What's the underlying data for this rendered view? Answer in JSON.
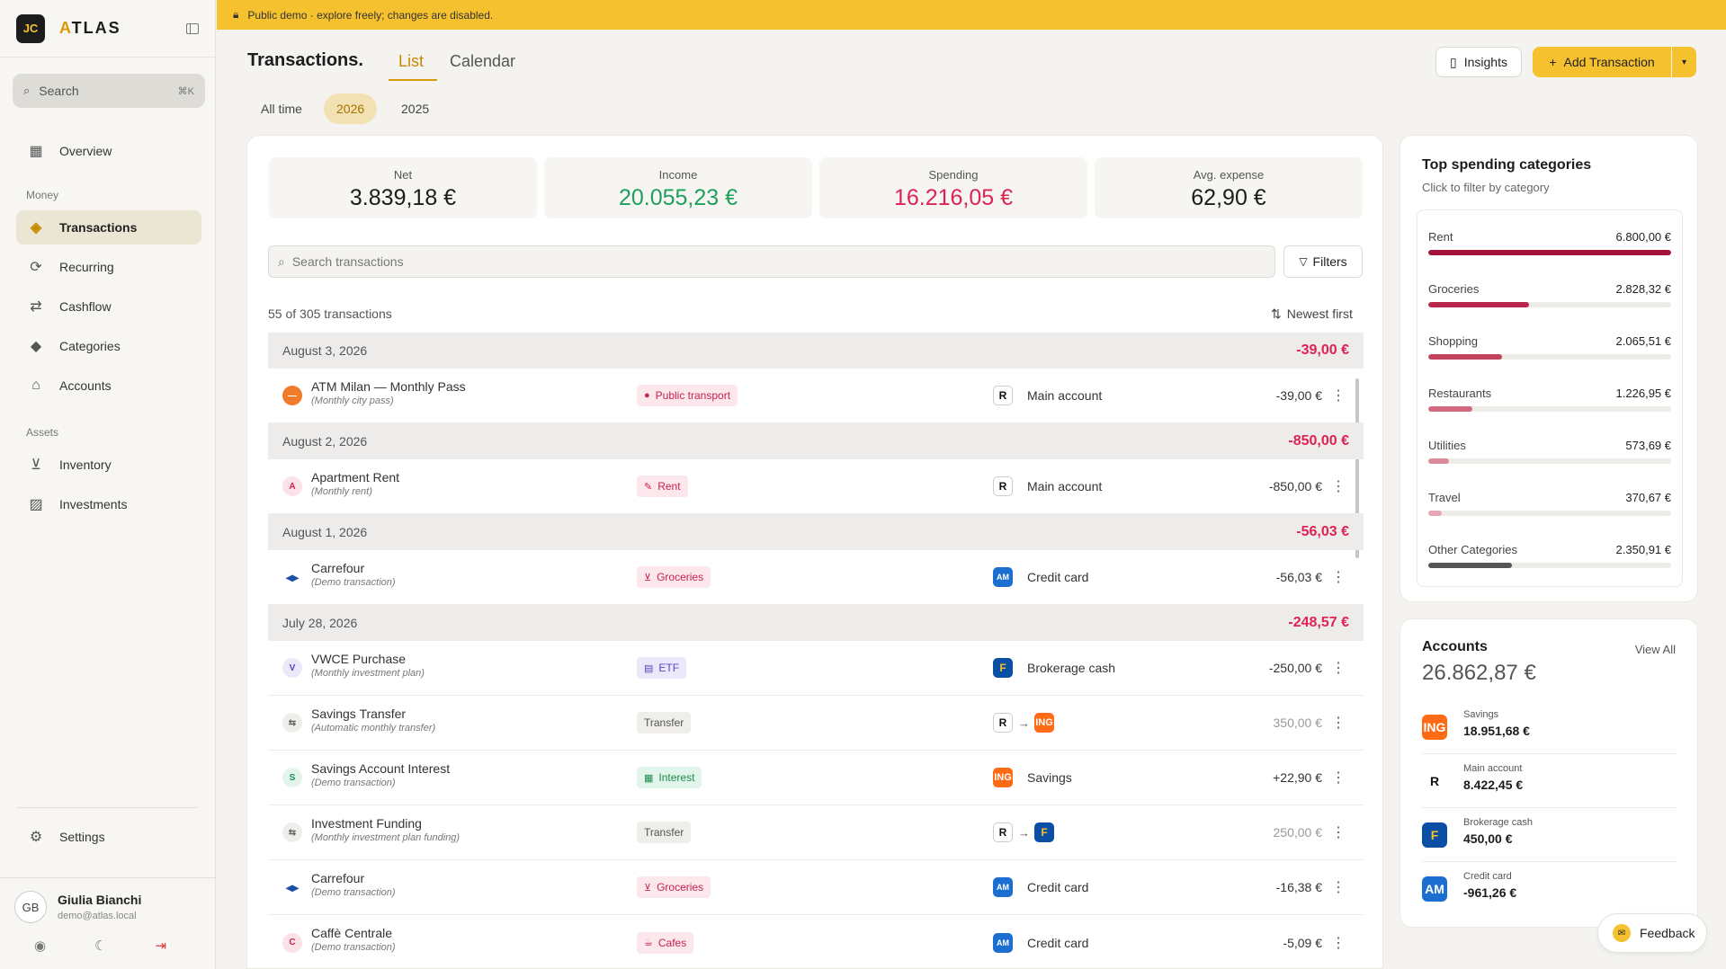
{
  "app": {
    "logo": "JC",
    "name_first": "A",
    "name_rest": "TLAS"
  },
  "search": {
    "placeholder": "Search",
    "shortcut": "⌘K"
  },
  "nav": {
    "overview": "Overview",
    "money_section": "Money",
    "transactions": "Transactions",
    "recurring": "Recurring",
    "cashflow": "Cashflow",
    "categories": "Categories",
    "accounts": "Accounts",
    "assets_section": "Assets",
    "inventory": "Inventory",
    "investments": "Investments",
    "settings": "Settings"
  },
  "user": {
    "initials": "GB",
    "name": "Giulia Bianchi",
    "email": "demo@atlas.local"
  },
  "banner": "Public demo · explore freely; changes are disabled.",
  "header": {
    "title": "Transactions.",
    "tab_list": "List",
    "tab_calendar": "Calendar",
    "insights": "Insights",
    "add": "Add Transaction"
  },
  "periods": {
    "all": "All time",
    "y2026": "2026",
    "y2025": "2025"
  },
  "stats": {
    "net_label": "Net",
    "net_value": "3.839,18 €",
    "income_label": "Income",
    "income_value": "20.055,23 €",
    "spending_label": "Spending",
    "spending_value": "16.216,05 €",
    "avg_label": "Avg. expense",
    "avg_value": "62,90 €"
  },
  "tx": {
    "search_placeholder": "Search transactions",
    "filters": "Filters",
    "count": "55 of 305 transactions",
    "sort": "Newest first"
  },
  "groups": [
    {
      "date": "August 3, 2026",
      "total": "-39,00 €"
    },
    {
      "date": "August 2, 2026",
      "total": "-850,00 €"
    },
    {
      "date": "August 1, 2026",
      "total": "-56,03 €"
    },
    {
      "date": "July 28, 2026",
      "total": "-248,57 €"
    }
  ],
  "rows": [
    {
      "name": "ATM Milan — Monthly Pass",
      "note": "(Monthly city pass)",
      "category": "Public transport",
      "account": "Main account",
      "amount": "-39,00 €"
    },
    {
      "name": "Apartment Rent",
      "note": "(Monthly rent)",
      "category": "Rent",
      "account": "Main account",
      "amount": "-850,00 €"
    },
    {
      "name": "Carrefour",
      "note": "(Demo transaction)",
      "category": "Groceries",
      "account": "Credit card",
      "amount": "-56,03 €"
    },
    {
      "name": "VWCE Purchase",
      "note": "(Monthly investment plan)",
      "category": "ETF",
      "account": "Brokerage cash",
      "amount": "-250,00 €"
    },
    {
      "name": "Savings Transfer",
      "note": "(Automatic monthly transfer)",
      "category": "Transfer",
      "account": "",
      "amount": "350,00 €"
    },
    {
      "name": "Savings Account Interest",
      "note": "(Demo transaction)",
      "category": "Interest",
      "account": "Savings",
      "amount": "+22,90 €"
    },
    {
      "name": "Investment Funding",
      "note": "(Monthly investment plan funding)",
      "category": "Transfer",
      "account": "",
      "amount": "250,00 €"
    },
    {
      "name": "Carrefour",
      "note": "(Demo transaction)",
      "category": "Groceries",
      "account": "Credit card",
      "amount": "-16,38 €"
    },
    {
      "name": "Caffè Centrale",
      "note": "(Demo transaction)",
      "category": "Cafes",
      "account": "Credit card",
      "amount": "-5,09 €"
    }
  ],
  "top_categories": {
    "title": "Top spending categories",
    "subtitle": "Click to filter by category",
    "items": [
      {
        "name": "Rent",
        "value": "6.800,00 €",
        "share": 1.0,
        "color": "#a3123a"
      },
      {
        "name": "Groceries",
        "value": "2.828,32 €",
        "share": 0.416,
        "color": "#b8264c"
      },
      {
        "name": "Shopping",
        "value": "2.065,51 €",
        "share": 0.304,
        "color": "#c4435f"
      },
      {
        "name": "Restaurants",
        "value": "1.226,95 €",
        "share": 0.18,
        "color": "#d26a7f"
      },
      {
        "name": "Utilities",
        "value": "573,69 €",
        "share": 0.084,
        "color": "#db8a9a"
      },
      {
        "name": "Travel",
        "value": "370,67 €",
        "share": 0.054,
        "color": "#e4a8b4"
      },
      {
        "name": "Other Categories",
        "value": "2.350,91 €",
        "share": 0.346,
        "color": "#555555"
      }
    ]
  },
  "accounts_card": {
    "title": "Accounts",
    "view_all": "View All",
    "total": "26.862,87 €",
    "items": [
      {
        "name": "Savings",
        "value": "18.951,68 €"
      },
      {
        "name": "Main account",
        "value": "8.422,45 €"
      },
      {
        "name": "Brokerage cash",
        "value": "450,00 €"
      },
      {
        "name": "Credit card",
        "value": "-961,26 €"
      }
    ]
  },
  "feedback": "Feedback"
}
